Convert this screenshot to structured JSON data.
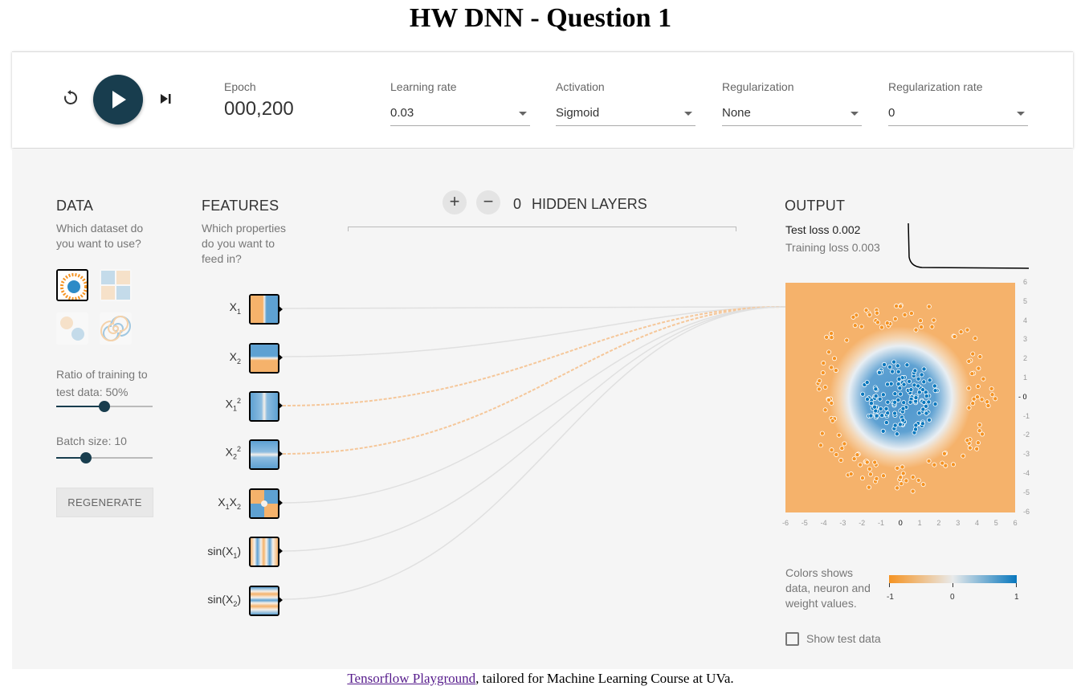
{
  "page": {
    "title": "HW DNN - Question 1",
    "footer_link": "Tensorflow Playground",
    "footer_text": ", tailored for Machine Learning Course at UVa."
  },
  "controls": {
    "reset_icon": "reset-icon",
    "play_icon": "play-icon",
    "step_icon": "step-forward-icon",
    "epoch_label": "Epoch",
    "epoch_value": "000,200",
    "selects": [
      {
        "label": "Learning rate",
        "value": "0.03"
      },
      {
        "label": "Activation",
        "value": "Sigmoid"
      },
      {
        "label": "Regularization",
        "value": "None"
      },
      {
        "label": "Regularization rate",
        "value": "0"
      }
    ]
  },
  "data_panel": {
    "title": "DATA",
    "subtitle_line1": "Which dataset do",
    "subtitle_line2": "you want to use?",
    "datasets": [
      "circle",
      "xor",
      "gaussian",
      "spiral"
    ],
    "selected_dataset": "circle",
    "ratio_label_line1": "Ratio of training to",
    "ratio_label_line2": "test data:  50%",
    "ratio_value": 0.5,
    "batch_label": "Batch size:  10",
    "batch_value": 0.3,
    "regenerate": "REGENERATE"
  },
  "features_panel": {
    "title": "FEATURES",
    "subtitle_line1": "Which properties",
    "subtitle_line2": "do you want to",
    "subtitle_line3": "feed in?",
    "features": [
      {
        "name": "X",
        "sub": "1",
        "sup": ""
      },
      {
        "name": "X",
        "sub": "2",
        "sup": ""
      },
      {
        "name": "X",
        "sub": "1",
        "sup": "2"
      },
      {
        "name": "X",
        "sub": "2",
        "sup": "2"
      },
      {
        "name": "X",
        "sub": "1",
        "mid": "X",
        "sub2": "2"
      },
      {
        "name": "sin(X",
        "sub": "1",
        "tail": ")"
      },
      {
        "name": "sin(X",
        "sub": "2",
        "tail": ")"
      }
    ]
  },
  "network": {
    "add_icon": "plus-icon",
    "remove_icon": "minus-icon",
    "hidden_layers_count": "0",
    "hidden_layers_label": "HIDDEN LAYERS"
  },
  "output_panel": {
    "title": "OUTPUT",
    "test_loss": "Test loss 0.002",
    "training_loss": "Training loss 0.003",
    "x_ticks": [
      "-6",
      "-5",
      "-4",
      "-3",
      "-2",
      "-1",
      "0",
      "1",
      "2",
      "3",
      "4",
      "5",
      "6"
    ],
    "y_ticks": [
      "6",
      "5",
      "4",
      "3",
      "2",
      "1",
      "0",
      "-1",
      "-2",
      "-3",
      "-4",
      "-5",
      "-6"
    ],
    "legend_line1": "Colors shows",
    "legend_line2": "data, neuron and",
    "legend_line3": "weight values.",
    "legend_min": "-1",
    "legend_mid": "0",
    "legend_max": "1",
    "show_test_data": "Show test data",
    "colors": {
      "orange": "#f59322",
      "blue": "#0877bd",
      "neutral": "#e8eaeb",
      "dark": "#183d4e"
    }
  }
}
